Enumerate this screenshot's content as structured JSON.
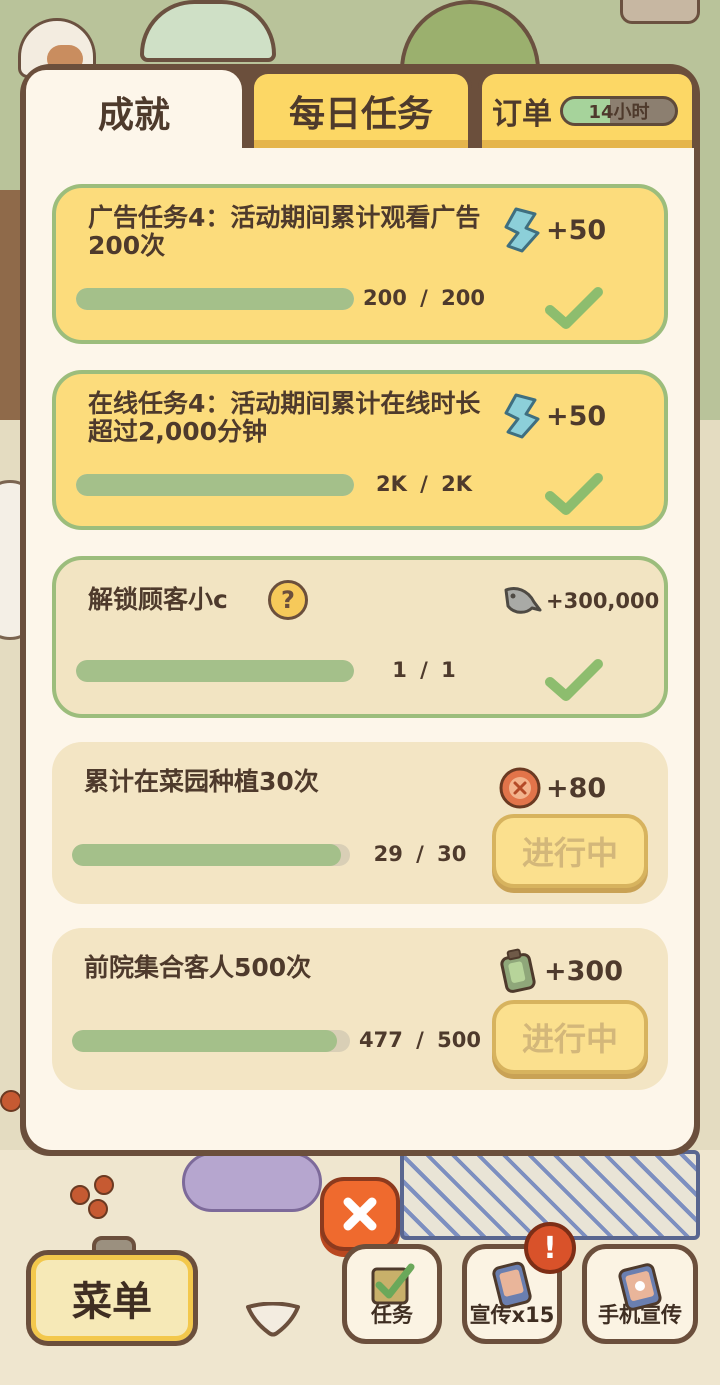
{
  "tabs": {
    "achievements": "成就",
    "daily_tasks": "每日任务",
    "orders": "订单",
    "order_timer": "14小时",
    "order_timer_progress": 0.42
  },
  "tasks": [
    {
      "title": "广告任务4：活动期间累计观看广告200次",
      "current": "200",
      "target": "200",
      "progress": 1.0,
      "reward_icon": "gem-icon",
      "reward_amount": "+50",
      "status": "completed"
    },
    {
      "title": "在线任务4：活动期间累计在线时长超过2,000分钟",
      "current": "2K",
      "target": "2K",
      "progress": 1.0,
      "reward_icon": "gem-icon",
      "reward_amount": "+50",
      "status": "completed"
    },
    {
      "title": "解锁顾客小c",
      "current": "1",
      "target": "1",
      "progress": 1.0,
      "reward_icon": "fish-icon",
      "reward_amount": "+300,000",
      "status": "completed",
      "help_icon": "?"
    },
    {
      "title": "累计在菜园种植30次",
      "current": "29",
      "target": "30",
      "progress": 0.967,
      "reward_icon": "button-token-icon",
      "reward_amount": "+80",
      "status": "in_progress",
      "button_label": "进行中"
    },
    {
      "title": "前院集合客人500次",
      "current": "477",
      "target": "500",
      "progress": 0.954,
      "reward_icon": "battery-icon",
      "reward_amount": "+300",
      "status": "in_progress",
      "button_label": "进行中"
    }
  ],
  "progress_separator": "/",
  "bottom_bar": {
    "menu_label": "菜单",
    "task_label": "任务",
    "promo_label": "宣传x15",
    "phone_promo_label": "手机宣传",
    "alert_badge": "!"
  },
  "colors": {
    "panel_bg": "#fdf6ea",
    "tab_active": "#fdf6ea",
    "tab_inactive": "#fcd765",
    "card_gold": "#fcdc7c",
    "card_cream": "#f3e5c4",
    "progress_fill": "#a4c08a",
    "check_green": "#8dbd6e",
    "close_orange": "#ef6a2e",
    "outline_brown": "#6b4f3c"
  }
}
